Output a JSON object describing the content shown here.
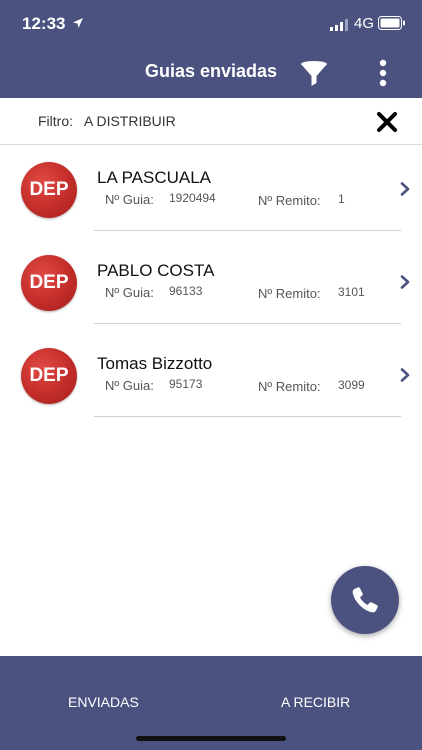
{
  "status_bar": {
    "time": "12:33",
    "network": "4G",
    "icons": [
      "location-arrow-icon",
      "signal-bars-icon",
      "battery-icon"
    ]
  },
  "header": {
    "title": "Guias enviadas",
    "icons": [
      "filter-icon",
      "more-vertical-icon"
    ]
  },
  "filter": {
    "label": "Filtro:",
    "value": "A DISTRIBUIR",
    "clear_icon": "close-icon"
  },
  "items": [
    {
      "badge": "DEP",
      "name": "LA PASCUALA",
      "guia_label": "Nº Guia:",
      "guia": "1920494",
      "remito_label": "Nº Remito:",
      "remito": "1"
    },
    {
      "badge": "DEP",
      "name": "PABLO COSTA",
      "guia_label": "Nº Guia:",
      "guia": "96133",
      "remito_label": "Nº Remito:",
      "remito": "3101"
    },
    {
      "badge": "DEP",
      "name": "Tomas Bizzotto",
      "guia_label": "Nº Guia:",
      "guia": "95173",
      "remito_label": "Nº Remito:",
      "remito": "3099"
    }
  ],
  "fab": {
    "icon": "phone-icon"
  },
  "bottom_nav": {
    "enviadas": "ENVIADAS",
    "recibir": "A RECIBIR"
  },
  "colors": {
    "primary": "#4b5280",
    "badge": "#c22d29",
    "chevron": "#4b5280"
  }
}
